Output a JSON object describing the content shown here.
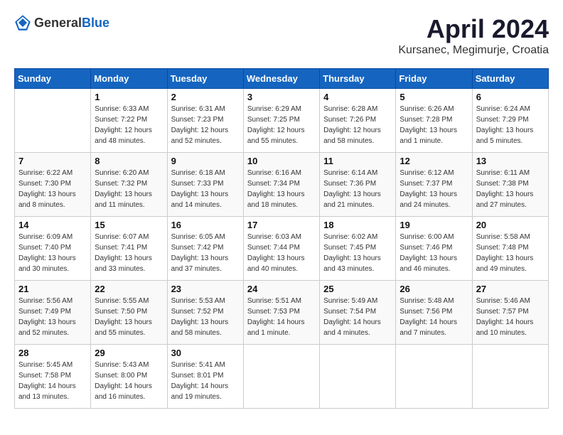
{
  "header": {
    "logo_general": "General",
    "logo_blue": "Blue",
    "month_year": "April 2024",
    "location": "Kursanec, Megimurje, Croatia"
  },
  "weekdays": [
    "Sunday",
    "Monday",
    "Tuesday",
    "Wednesday",
    "Thursday",
    "Friday",
    "Saturday"
  ],
  "weeks": [
    [
      {
        "day": "",
        "sunrise": "",
        "sunset": "",
        "daylight": ""
      },
      {
        "day": "1",
        "sunrise": "Sunrise: 6:33 AM",
        "sunset": "Sunset: 7:22 PM",
        "daylight": "Daylight: 12 hours and 48 minutes."
      },
      {
        "day": "2",
        "sunrise": "Sunrise: 6:31 AM",
        "sunset": "Sunset: 7:23 PM",
        "daylight": "Daylight: 12 hours and 52 minutes."
      },
      {
        "day": "3",
        "sunrise": "Sunrise: 6:29 AM",
        "sunset": "Sunset: 7:25 PM",
        "daylight": "Daylight: 12 hours and 55 minutes."
      },
      {
        "day": "4",
        "sunrise": "Sunrise: 6:28 AM",
        "sunset": "Sunset: 7:26 PM",
        "daylight": "Daylight: 12 hours and 58 minutes."
      },
      {
        "day": "5",
        "sunrise": "Sunrise: 6:26 AM",
        "sunset": "Sunset: 7:28 PM",
        "daylight": "Daylight: 13 hours and 1 minute."
      },
      {
        "day": "6",
        "sunrise": "Sunrise: 6:24 AM",
        "sunset": "Sunset: 7:29 PM",
        "daylight": "Daylight: 13 hours and 5 minutes."
      }
    ],
    [
      {
        "day": "7",
        "sunrise": "Sunrise: 6:22 AM",
        "sunset": "Sunset: 7:30 PM",
        "daylight": "Daylight: 13 hours and 8 minutes."
      },
      {
        "day": "8",
        "sunrise": "Sunrise: 6:20 AM",
        "sunset": "Sunset: 7:32 PM",
        "daylight": "Daylight: 13 hours and 11 minutes."
      },
      {
        "day": "9",
        "sunrise": "Sunrise: 6:18 AM",
        "sunset": "Sunset: 7:33 PM",
        "daylight": "Daylight: 13 hours and 14 minutes."
      },
      {
        "day": "10",
        "sunrise": "Sunrise: 6:16 AM",
        "sunset": "Sunset: 7:34 PM",
        "daylight": "Daylight: 13 hours and 18 minutes."
      },
      {
        "day": "11",
        "sunrise": "Sunrise: 6:14 AM",
        "sunset": "Sunset: 7:36 PM",
        "daylight": "Daylight: 13 hours and 21 minutes."
      },
      {
        "day": "12",
        "sunrise": "Sunrise: 6:12 AM",
        "sunset": "Sunset: 7:37 PM",
        "daylight": "Daylight: 13 hours and 24 minutes."
      },
      {
        "day": "13",
        "sunrise": "Sunrise: 6:11 AM",
        "sunset": "Sunset: 7:38 PM",
        "daylight": "Daylight: 13 hours and 27 minutes."
      }
    ],
    [
      {
        "day": "14",
        "sunrise": "Sunrise: 6:09 AM",
        "sunset": "Sunset: 7:40 PM",
        "daylight": "Daylight: 13 hours and 30 minutes."
      },
      {
        "day": "15",
        "sunrise": "Sunrise: 6:07 AM",
        "sunset": "Sunset: 7:41 PM",
        "daylight": "Daylight: 13 hours and 33 minutes."
      },
      {
        "day": "16",
        "sunrise": "Sunrise: 6:05 AM",
        "sunset": "Sunset: 7:42 PM",
        "daylight": "Daylight: 13 hours and 37 minutes."
      },
      {
        "day": "17",
        "sunrise": "Sunrise: 6:03 AM",
        "sunset": "Sunset: 7:44 PM",
        "daylight": "Daylight: 13 hours and 40 minutes."
      },
      {
        "day": "18",
        "sunrise": "Sunrise: 6:02 AM",
        "sunset": "Sunset: 7:45 PM",
        "daylight": "Daylight: 13 hours and 43 minutes."
      },
      {
        "day": "19",
        "sunrise": "Sunrise: 6:00 AM",
        "sunset": "Sunset: 7:46 PM",
        "daylight": "Daylight: 13 hours and 46 minutes."
      },
      {
        "day": "20",
        "sunrise": "Sunrise: 5:58 AM",
        "sunset": "Sunset: 7:48 PM",
        "daylight": "Daylight: 13 hours and 49 minutes."
      }
    ],
    [
      {
        "day": "21",
        "sunrise": "Sunrise: 5:56 AM",
        "sunset": "Sunset: 7:49 PM",
        "daylight": "Daylight: 13 hours and 52 minutes."
      },
      {
        "day": "22",
        "sunrise": "Sunrise: 5:55 AM",
        "sunset": "Sunset: 7:50 PM",
        "daylight": "Daylight: 13 hours and 55 minutes."
      },
      {
        "day": "23",
        "sunrise": "Sunrise: 5:53 AM",
        "sunset": "Sunset: 7:52 PM",
        "daylight": "Daylight: 13 hours and 58 minutes."
      },
      {
        "day": "24",
        "sunrise": "Sunrise: 5:51 AM",
        "sunset": "Sunset: 7:53 PM",
        "daylight": "Daylight: 14 hours and 1 minute."
      },
      {
        "day": "25",
        "sunrise": "Sunrise: 5:49 AM",
        "sunset": "Sunset: 7:54 PM",
        "daylight": "Daylight: 14 hours and 4 minutes."
      },
      {
        "day": "26",
        "sunrise": "Sunrise: 5:48 AM",
        "sunset": "Sunset: 7:56 PM",
        "daylight": "Daylight: 14 hours and 7 minutes."
      },
      {
        "day": "27",
        "sunrise": "Sunrise: 5:46 AM",
        "sunset": "Sunset: 7:57 PM",
        "daylight": "Daylight: 14 hours and 10 minutes."
      }
    ],
    [
      {
        "day": "28",
        "sunrise": "Sunrise: 5:45 AM",
        "sunset": "Sunset: 7:58 PM",
        "daylight": "Daylight: 14 hours and 13 minutes."
      },
      {
        "day": "29",
        "sunrise": "Sunrise: 5:43 AM",
        "sunset": "Sunset: 8:00 PM",
        "daylight": "Daylight: 14 hours and 16 minutes."
      },
      {
        "day": "30",
        "sunrise": "Sunrise: 5:41 AM",
        "sunset": "Sunset: 8:01 PM",
        "daylight": "Daylight: 14 hours and 19 minutes."
      },
      {
        "day": "",
        "sunrise": "",
        "sunset": "",
        "daylight": ""
      },
      {
        "day": "",
        "sunrise": "",
        "sunset": "",
        "daylight": ""
      },
      {
        "day": "",
        "sunrise": "",
        "sunset": "",
        "daylight": ""
      },
      {
        "day": "",
        "sunrise": "",
        "sunset": "",
        "daylight": ""
      }
    ]
  ]
}
